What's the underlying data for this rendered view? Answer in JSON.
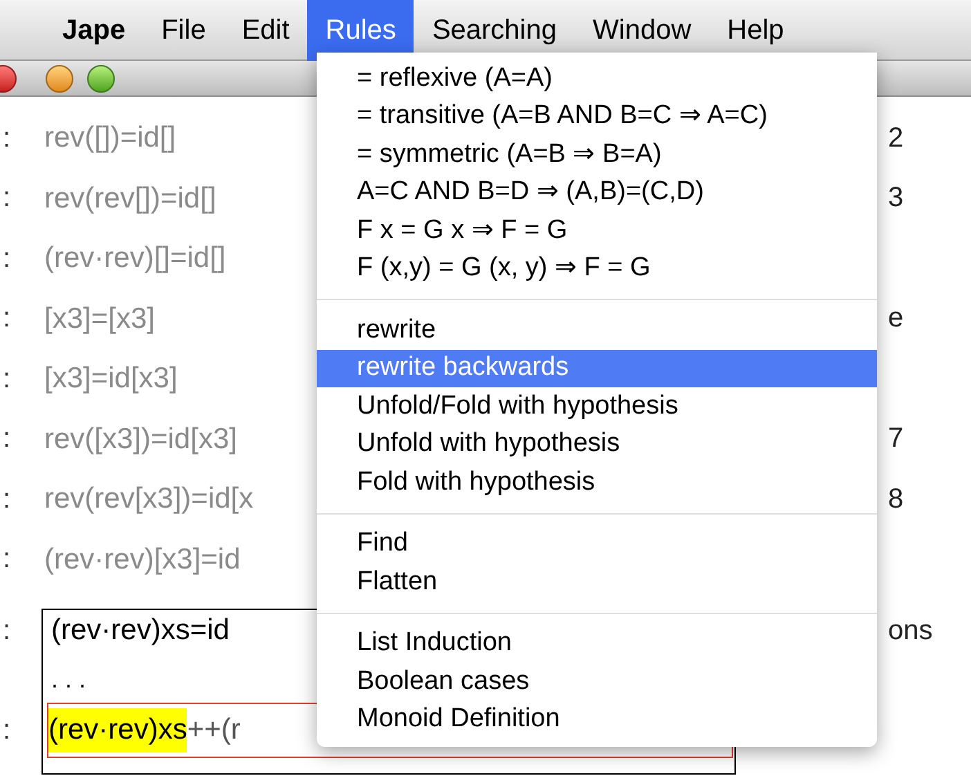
{
  "menubar": [
    {
      "label": "Jape",
      "bold": true,
      "selected": false
    },
    {
      "label": "File",
      "bold": false,
      "selected": false
    },
    {
      "label": "Edit",
      "bold": false,
      "selected": false
    },
    {
      "label": "Rules",
      "bold": false,
      "selected": true
    },
    {
      "label": "Searching",
      "bold": false,
      "selected": false
    },
    {
      "label": "Window",
      "bold": false,
      "selected": false
    },
    {
      "label": "Help",
      "bold": false,
      "selected": false
    }
  ],
  "proof_lines": [
    {
      "kind": "done",
      "number": ":",
      "formula": "rev([])=id[]",
      "justification": "2"
    },
    {
      "kind": "done",
      "number": ":",
      "formula": "rev(rev[])=id[]",
      "justification": "3"
    },
    {
      "kind": "done",
      "number": ":",
      "formula": "(rev·rev)[]=id[]"
    },
    {
      "kind": "done",
      "number": ":",
      "formula": "[x3]=[x3]",
      "justification": "e"
    },
    {
      "kind": "done",
      "number": ":",
      "formula": "[x3]=id[x3]"
    },
    {
      "kind": "done",
      "number": ":",
      "formula": "rev([x3])=id[x3]",
      "justification": "7"
    },
    {
      "kind": "done",
      "number": ":",
      "formula": "rev(rev[x3])=id[x",
      "justification": "8"
    },
    {
      "kind": "done",
      "number": ":",
      "formula": "(rev·rev)[x3]=id"
    },
    {
      "kind": "open",
      "number": ":",
      "formula": "(rev·rev)xs=id",
      "justification": "ons"
    },
    {
      "kind": "ellipsis",
      "formula": ". . ."
    },
    {
      "kind": "goal",
      "number": ":",
      "highlight": "(rev·rev)xs",
      "formula": "++(r"
    }
  ],
  "menu": {
    "groups": [
      [
        {
          "label": "= reflexive (A=A)",
          "selected": false
        },
        {
          "label": "= transitive (A=B AND B=C ⇒ A=C)",
          "selected": false
        },
        {
          "label": "= symmetric (A=B ⇒ B=A)",
          "selected": false
        },
        {
          "label": "A=C AND B=D ⇒ (A,B)=(C,D)",
          "selected": false
        },
        {
          "label": "F x = G x ⇒ F = G",
          "selected": false
        },
        {
          "label": "F (x,y) = G (x, y) ⇒ F = G",
          "selected": false
        }
      ],
      [
        {
          "label": "rewrite",
          "selected": false
        },
        {
          "label": "rewrite backwards",
          "selected": true
        },
        {
          "label": "Unfold/Fold with hypothesis",
          "selected": false
        },
        {
          "label": "Unfold with hypothesis",
          "selected": false
        },
        {
          "label": "Fold with hypothesis",
          "selected": false
        }
      ],
      [
        {
          "label": "Find",
          "selected": false
        },
        {
          "label": "Flatten",
          "selected": false
        }
      ],
      [
        {
          "label": "List Induction",
          "selected": false
        },
        {
          "label": "Boolean cases",
          "selected": false
        },
        {
          "label": "Monoid Definition",
          "selected": false
        }
      ]
    ]
  }
}
